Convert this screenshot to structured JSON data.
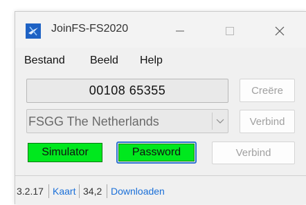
{
  "window": {
    "title": "JoinFS-FS2020",
    "controls": {
      "minimize": "—",
      "maximize": "☐",
      "close": "✕"
    }
  },
  "menu": [
    "Bestand",
    "Beeld",
    "Help"
  ],
  "session": {
    "code": "00108 65355",
    "create_label": "Creëre"
  },
  "server": {
    "selected": "FSGG The Netherlands",
    "connect_label": "Verbind"
  },
  "status_buttons": {
    "simulator": "Simulator",
    "password": "Password",
    "connect_label": "Verbind"
  },
  "statusbar": {
    "version": "3.2.17",
    "map_link": "Kaart",
    "value": "34,2",
    "download_link": "Downloaden"
  },
  "colors": {
    "status_green": "#00e81e",
    "link_blue": "#1a6fd8",
    "focus_border": "#2a6fcf"
  },
  "icons": [
    "app-icon",
    "minimize-icon",
    "maximize-icon",
    "close-icon",
    "chevron-down-icon"
  ]
}
